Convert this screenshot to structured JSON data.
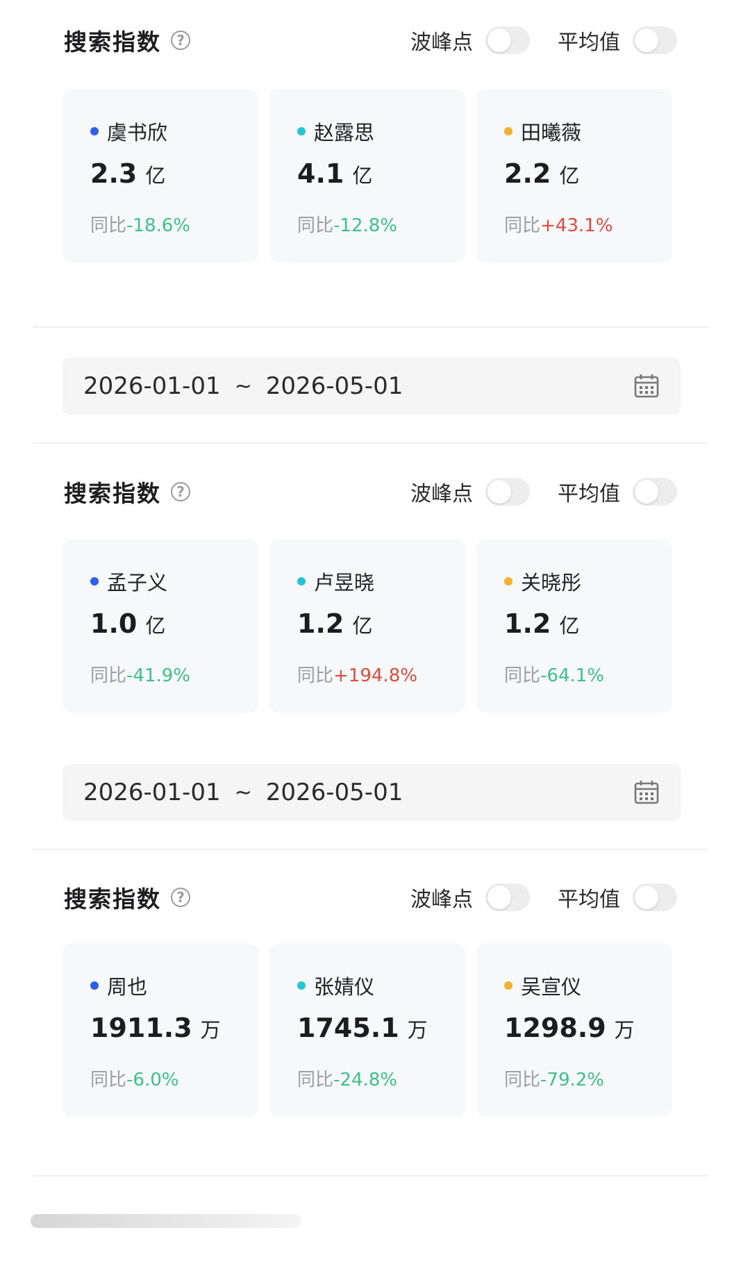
{
  "sections": [
    {
      "title": "搜索指数",
      "peak_label": "波峰点",
      "avg_label": "平均值",
      "cards": [
        {
          "name": "虞书欣",
          "value": "2.3",
          "unit": "亿",
          "yoy_label": "同比",
          "yoy": "-18.6%",
          "dot_color": "#2f5fe8",
          "trend": "neg"
        },
        {
          "name": "赵露思",
          "value": "4.1",
          "unit": "亿",
          "yoy_label": "同比",
          "yoy": "-12.8%",
          "dot_color": "#25c6cf",
          "trend": "neg"
        },
        {
          "name": "田曦薇",
          "value": "2.2",
          "unit": "亿",
          "yoy_label": "同比",
          "yoy": "+43.1%",
          "dot_color": "#f2b230",
          "trend": "pos"
        }
      ]
    },
    {
      "title": "搜索指数",
      "peak_label": "波峰点",
      "avg_label": "平均值",
      "cards": [
        {
          "name": "孟子义",
          "value": "1.0",
          "unit": "亿",
          "yoy_label": "同比",
          "yoy": "-41.9%",
          "dot_color": "#2f5fe8",
          "trend": "neg"
        },
        {
          "name": "卢昱晓",
          "value": "1.2",
          "unit": "亿",
          "yoy_label": "同比",
          "yoy": "+194.8%",
          "dot_color": "#25c6cf",
          "trend": "pos"
        },
        {
          "name": "关晓彤",
          "value": "1.2",
          "unit": "亿",
          "yoy_label": "同比",
          "yoy": "-64.1%",
          "dot_color": "#f2b230",
          "trend": "neg"
        }
      ]
    },
    {
      "title": "搜索指数",
      "peak_label": "波峰点",
      "avg_label": "平均值",
      "cards": [
        {
          "name": "周也",
          "value": "1911.3",
          "unit": "万",
          "yoy_label": "同比",
          "yoy": "-6.0%",
          "dot_color": "#2f5fe8",
          "trend": "neg"
        },
        {
          "name": "张婧仪",
          "value": "1745.1",
          "unit": "万",
          "yoy_label": "同比",
          "yoy": "-24.8%",
          "dot_color": "#25c6cf",
          "trend": "neg"
        },
        {
          "name": "吴宣仪",
          "value": "1298.9",
          "unit": "万",
          "yoy_label": "同比",
          "yoy": "-79.2%",
          "dot_color": "#f2b230",
          "trend": "neg"
        }
      ]
    }
  ],
  "date_ranges": [
    {
      "start": "2026-01-01",
      "sep": "~",
      "end": "2026-05-01"
    },
    {
      "start": "2026-01-01",
      "sep": "~",
      "end": "2026-05-01"
    }
  ],
  "colors": {
    "negative": "#3cc18a",
    "positive": "#e24a3b"
  },
  "icons": {
    "help": "question-circle-icon",
    "calendar": "calendar-icon"
  }
}
